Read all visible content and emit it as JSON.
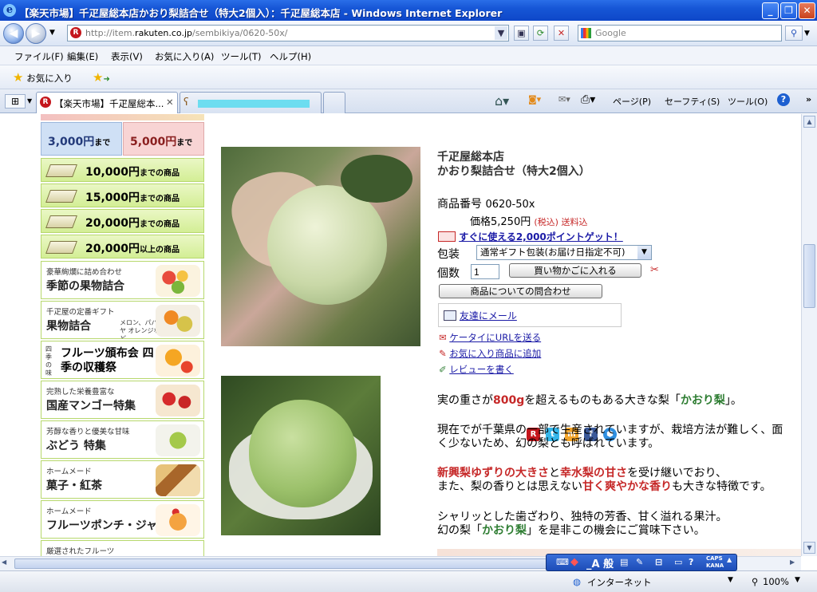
{
  "window": {
    "title": "【楽天市場】千疋屋総本店かおり梨詰合せ（特大2個入）：千疋屋総本店 - Windows Internet Explorer"
  },
  "address": {
    "url_prefix": "http://item.",
    "url_domain": "rakuten.co.jp",
    "url_path": "/sembikiya/0620-50x/",
    "search_placeholder": "Google"
  },
  "menu": [
    "ファイル(F)",
    "編集(E)",
    "表示(V)",
    "お気に入り(A)",
    "ツール(T)",
    "ヘルプ(H)"
  ],
  "favorites": {
    "label": "お気に入り"
  },
  "tabs": [
    {
      "label": "【楽天市場】千疋屋総本..."
    }
  ],
  "commands": [
    "ページ(P)",
    "セーフティ(S)",
    "ツール(O)"
  ],
  "sidebar": {
    "price_tabs": [
      {
        "amount": "3,000円",
        "suffix": "まで",
        "color": "#cfe0f5"
      },
      {
        "amount": "5,000円",
        "suffix": "まで",
        "color": "#f8d4d4"
      }
    ],
    "price_rows": [
      {
        "amount": "10,000円",
        "suffix": "までの商品"
      },
      {
        "amount": "15,000円",
        "suffix": "までの商品"
      },
      {
        "amount": "20,000円",
        "suffix": "までの商品"
      },
      {
        "amount": "20,000円",
        "suffix": "以上の商品"
      }
    ],
    "banners": [
      {
        "sub": "豪華絢爛に詰め合わせ",
        "main": "季節の果物詰合"
      },
      {
        "sub": "千疋屋の定番ギフト",
        "main": "果物詰合",
        "extra": "メロン、パパイヤ オレンジなど"
      },
      {
        "sub": "四季の味",
        "main": "フルーツ頒布会 四季の収穫祭"
      },
      {
        "sub": "完熟した栄養豊富な",
        "main": "国産マンゴー特集"
      },
      {
        "sub": "芳醇な香りと優美な甘味",
        "main": "ぶどう 特集"
      },
      {
        "sub": "ホームメード",
        "main": "菓子・紅茶"
      },
      {
        "sub": "ホームメード",
        "main": "フルーツポンチ・ジャム"
      },
      {
        "sub": "厳選されたフルーツ",
        "main": ""
      }
    ]
  },
  "product": {
    "shop": "千疋屋総本店",
    "name": "かおり梨詰合せ（特大2個入）",
    "code_label": "商品番号",
    "code": "0620-50x",
    "price_label": "価格5,250円",
    "tax_note": "(税込) 送料込",
    "points": "すぐに使える2,000ポイントゲット！",
    "wrap_label": "包装",
    "wrap_value": "通常ギフト包装(お届け日指定不可)",
    "qty_label": "個数",
    "qty_value": "1",
    "cart_button": "買い物かごに入れる",
    "inquiry_button": "商品についての問合わせ",
    "share_email": "友達にメール",
    "links": [
      "ケータイにURLを送る",
      "お気に入り商品に追加",
      "レビューを書く"
    ],
    "description": {
      "p1a": "実の重さが",
      "p1b": "800g",
      "p1c": "を超えるものもある大きな梨「",
      "p1d": "かおり梨",
      "p1e": "」。",
      "p2a": "現在でが千葉県の一部で生産されていますが、栽培方法が難しく、面",
      "p2b": "く少ないため、幻の梨とも呼ばれています。",
      "p3a": "新興梨ゆずりの大きさ",
      "p3b": "と",
      "p3c": "幸水梨の甘さ",
      "p3d": "を受け継いでおり、",
      "p3e": "また、梨の香りとは思えない",
      "p3f": "甘く爽やかな香り",
      "p3g": "も大きな特徴です。",
      "p4a": "シャリッとした歯ざわり、独特の芳香、甘く溢れる果汁。",
      "p4b": "幻の梨「",
      "p4c": "かおり梨",
      "p4d": "」を是非この機会にご賞味下さい。"
    }
  },
  "status": {
    "zone": "インターネット",
    "zoom": "100%"
  },
  "ime": {
    "mode": "_A 般",
    "caps": "CAPS",
    "kana": "KANA"
  }
}
